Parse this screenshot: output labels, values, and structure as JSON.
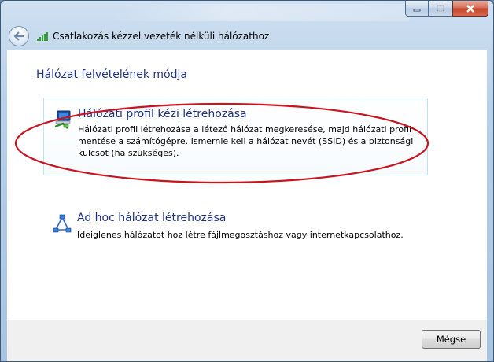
{
  "window": {
    "title": "Csatlakozás kézzel vezeték nélküli hálózathoz"
  },
  "titlebar_buttons": {
    "minimize_icon": "minimize-icon",
    "maximize_icon": "maximize-icon",
    "close_icon": "close-icon"
  },
  "main": {
    "heading": "Hálózat felvételének módja",
    "options": [
      {
        "title": "Hálózati profil kézi létrehozása",
        "description": "Hálózati profil létrehozása a létező hálózat megkeresése, majd hálózati profil mentése a számítógépre. Ismernie kell a hálózat nevét (SSID) és a biztonsági kulcsot (ha szükséges).",
        "icon": "network-profile-icon"
      },
      {
        "title": "Ad hoc hálózat létrehozása",
        "description": "Ideiglenes hálózatot hoz létre fájlmegosztáshoz vagy internetkapcsolathoz.",
        "icon": "adhoc-network-icon"
      }
    ]
  },
  "footer": {
    "cancel_label": "Mégse"
  },
  "colors": {
    "link_blue": "#1e3287",
    "highlight_border": "#bde2f3",
    "annotation_red": "#c8141e"
  }
}
